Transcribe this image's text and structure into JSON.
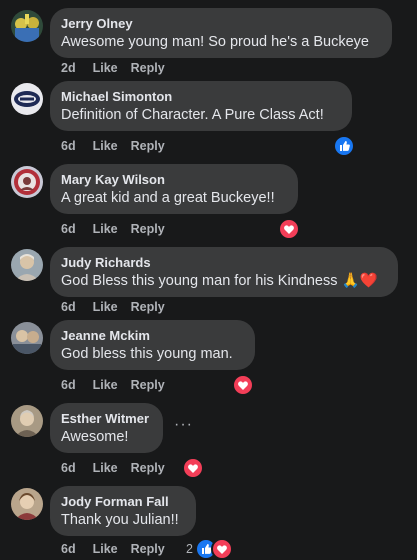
{
  "comments": [
    {
      "author": "Jerry Olney",
      "text": "Awesome young man! So proud he's a Buckeye",
      "time": "2d",
      "like": "Like",
      "reply": "Reply"
    },
    {
      "author": "Michael Simonton",
      "text": "Definition of Character. A Pure Class Act!",
      "time": "6d",
      "like": "Like",
      "reply": "Reply",
      "reactions": [
        "like"
      ]
    },
    {
      "author": "Mary Kay Wilson",
      "text": "A great kid and a great Buckeye!!",
      "time": "6d",
      "like": "Like",
      "reply": "Reply",
      "reactions": [
        "love"
      ]
    },
    {
      "author": "Judy Richards",
      "text": "God Bless this young man for his Kindness 🙏❤️",
      "time": "6d",
      "like": "Like",
      "reply": "Reply"
    },
    {
      "author": "Jeanne Mckim",
      "text": "God bless this young man.",
      "time": "6d",
      "like": "Like",
      "reply": "Reply",
      "reactions": [
        "love"
      ]
    },
    {
      "author": "Esther Witmer",
      "text": "Awesome!",
      "time": "6d",
      "like": "Like",
      "reply": "Reply",
      "reactions": [
        "love"
      ],
      "more": "···"
    },
    {
      "author": "Jody Forman Fall",
      "text": "Thank you Julian!!",
      "time": "6d",
      "like": "Like",
      "reply": "Reply",
      "reactions": [
        "like",
        "love"
      ],
      "reaction_count": "2"
    }
  ],
  "colors": {
    "background": "#18191a",
    "bubble": "#3a3b3c",
    "text": "#e4e6eb",
    "secondary": "#b0b3b8",
    "like_reaction": "#1877f2",
    "love_reaction": "#f33e58"
  },
  "icons": {
    "like": "thumbs-up-icon",
    "love": "heart-icon",
    "more": "more-options-icon"
  }
}
